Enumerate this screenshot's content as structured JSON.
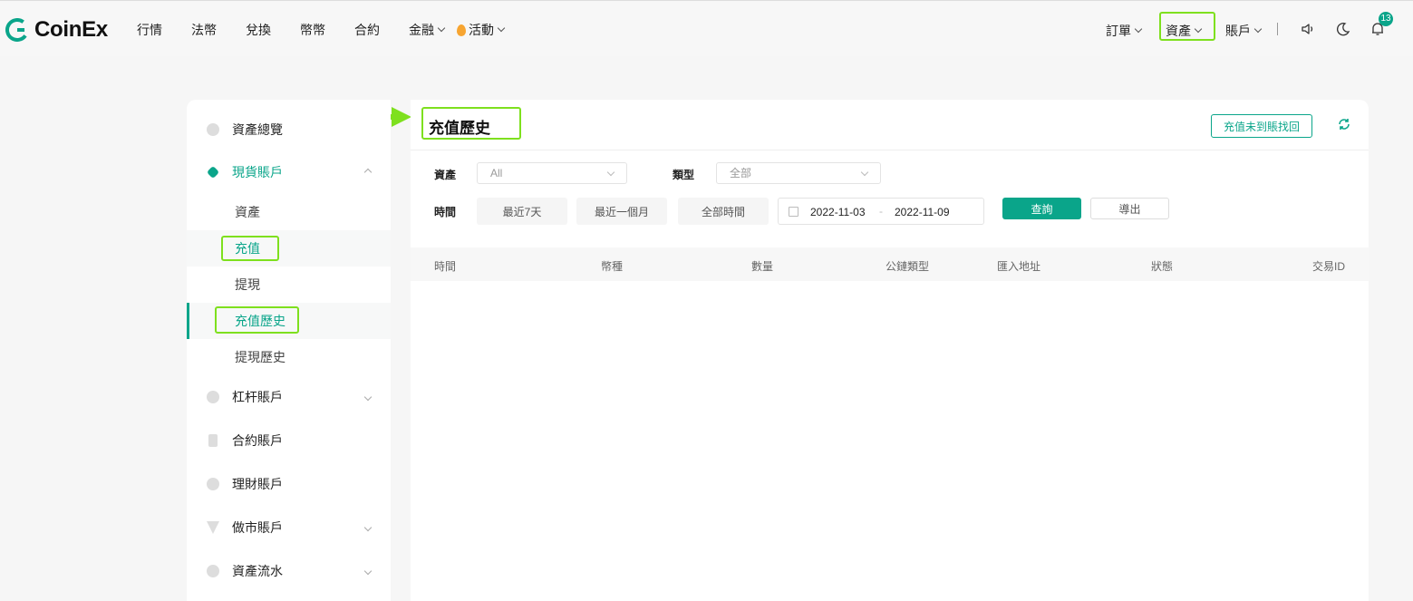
{
  "brand": {
    "name": "CoinEx"
  },
  "nav": {
    "items": [
      {
        "label": "行情",
        "dropdown": false
      },
      {
        "label": "法幣",
        "dropdown": false
      },
      {
        "label": "兌換",
        "dropdown": false
      },
      {
        "label": "幣幣",
        "dropdown": false
      },
      {
        "label": "合約",
        "dropdown": false
      },
      {
        "label": "金融",
        "dropdown": true
      },
      {
        "label": "活動",
        "dropdown": true
      }
    ],
    "right": {
      "orders": "訂單",
      "assets": "資產",
      "account": "賬戶",
      "notification_count": "13"
    }
  },
  "sidebar": {
    "overview": "資產總覽",
    "spot": "現貨賬戶",
    "spot_sub": {
      "assets": "資產",
      "deposit": "充值",
      "withdraw": "提現",
      "deposit_history": "充值歷史",
      "withdraw_history": "提現歷史"
    },
    "margin": "杠杆賬戶",
    "futures": "合約賬戶",
    "finance": "理財賬戶",
    "market_maker": "做市賬戶",
    "ledger": "資產流水"
  },
  "main": {
    "title": "充值歷史",
    "recover_button": "充值未到賬找回",
    "filters": {
      "asset_label": "資產",
      "asset_value": "All",
      "type_label": "類型",
      "type_value": "全部",
      "time_label": "時間",
      "quick_ranges": [
        "最近7天",
        "最近一個月",
        "全部時間"
      ],
      "date_from": "2022-11-03",
      "date_separator": "-",
      "date_to": "2022-11-09",
      "search_button": "查詢",
      "export_button": "導出"
    },
    "table": {
      "columns": [
        "時間",
        "幣種",
        "數量",
        "公鏈類型",
        "匯入地址",
        "狀態",
        "交易ID"
      ]
    }
  },
  "colors": {
    "accent": "#0aa58a",
    "annotation": "#7ee01e"
  }
}
